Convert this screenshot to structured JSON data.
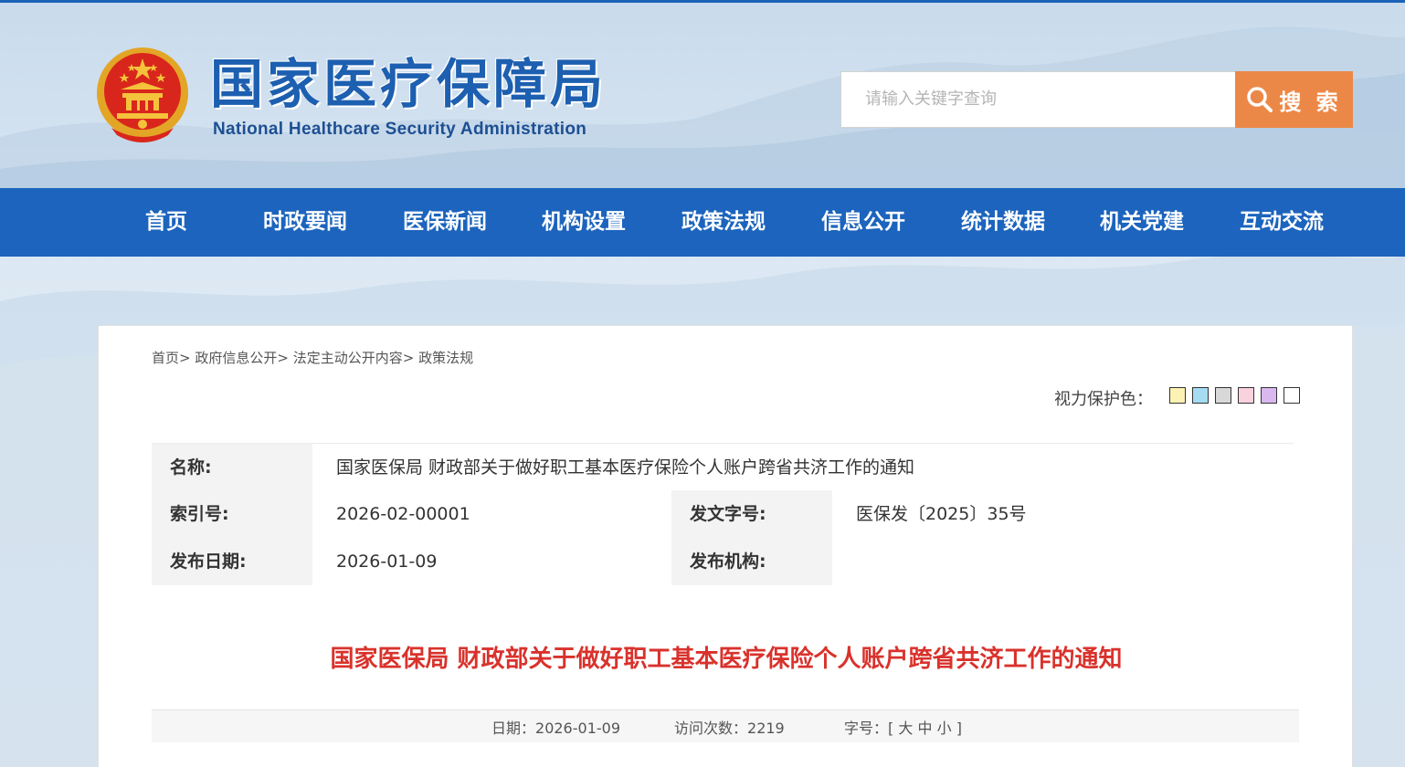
{
  "site": {
    "title_cn": "国家医疗保障局",
    "title_en": "National Healthcare Security Administration"
  },
  "search": {
    "placeholder": "请输入关键字查询",
    "button_label": "搜 索"
  },
  "nav": {
    "items": [
      {
        "label": "首页"
      },
      {
        "label": "时政要闻"
      },
      {
        "label": "医保新闻"
      },
      {
        "label": "机构设置"
      },
      {
        "label": "政策法规"
      },
      {
        "label": "信息公开"
      },
      {
        "label": "统计数据"
      },
      {
        "label": "机关党建"
      },
      {
        "label": "互动交流"
      }
    ]
  },
  "breadcrumb": {
    "items": [
      "首页",
      "政府信息公开",
      "法定主动公开内容",
      "政策法规"
    ],
    "separator": ">"
  },
  "eye_care": {
    "label": "视力保护色：",
    "colors": [
      "#fbf2b4",
      "#a6dcf2",
      "#d8d8d8",
      "#f9d2de",
      "#d9b8f0",
      "#ffffff"
    ]
  },
  "meta": {
    "name_label": "名称:",
    "name_value": "国家医保局 财政部关于做好职工基本医疗保险个人账户跨省共济工作的通知",
    "index_label": "索引号:",
    "index_value": "2026-02-00001",
    "docno_label": "发文字号:",
    "docno_value": "医保发〔2025〕35号",
    "date_label": "发布日期:",
    "date_value": "2026-01-09",
    "org_label": "发布机构:",
    "org_value": ""
  },
  "document": {
    "title": "国家医保局 财政部关于做好职工基本医疗保险个人账户跨省共济工作的通知"
  },
  "info_bar": {
    "date_label": "日期：",
    "date_value": "2026-01-09",
    "visits_label": "访问次数：",
    "visits_value": "2219",
    "font_label": "字号：",
    "bracket_open": "[",
    "size_large": "大",
    "size_medium": "中",
    "size_small": "小",
    "bracket_close": "]"
  }
}
